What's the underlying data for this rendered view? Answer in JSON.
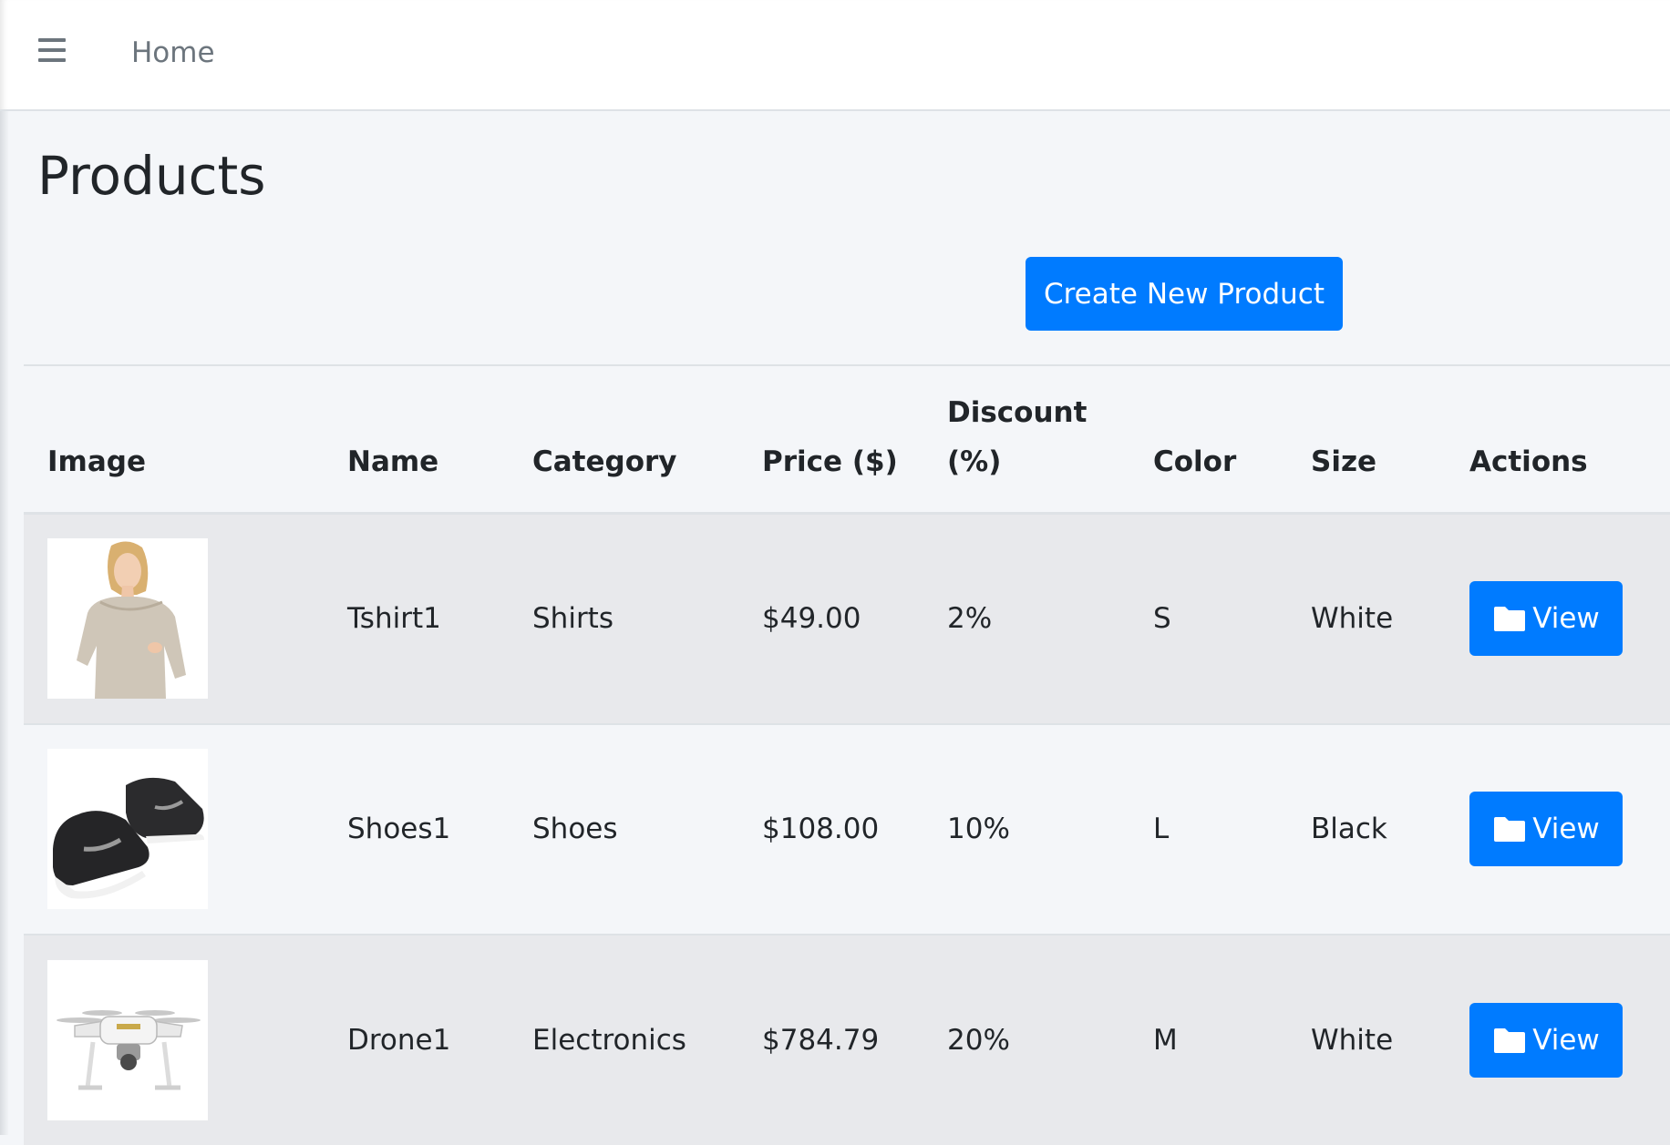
{
  "navbar": {
    "menu_icon": "hamburger-menu-icon",
    "home_label": "Home"
  },
  "page": {
    "title": "Products",
    "create_button_label": "Create New Product"
  },
  "colors": {
    "primary": "#007bff",
    "background": "#f4f6f9",
    "striped_row": "#e8e9ec"
  },
  "table": {
    "headers": {
      "image": "Image",
      "name": "Name",
      "category": "Category",
      "price": "Price ($)",
      "discount_line1": "Discount",
      "discount_line2": "(%)",
      "color": "Color",
      "size": "Size",
      "actions": "Actions"
    },
    "rows": [
      {
        "image": "woman-sweater-photo",
        "name": "Tshirt1",
        "category": "Shirts",
        "price": "$49.00",
        "discount": "2%",
        "color": "S",
        "size": "White",
        "action_label": "View",
        "action_icon": "folder-icon"
      },
      {
        "image": "black-sneakers-photo",
        "name": "Shoes1",
        "category": "Shoes",
        "price": "$108.00",
        "discount": "10%",
        "color": "L",
        "size": "Black",
        "action_label": "View",
        "action_icon": "folder-icon"
      },
      {
        "image": "white-drone-photo",
        "name": "Drone1",
        "category": "Electronics",
        "price": "$784.79",
        "discount": "20%",
        "color": "M",
        "size": "White",
        "action_label": "View",
        "action_icon": "folder-icon"
      }
    ]
  }
}
